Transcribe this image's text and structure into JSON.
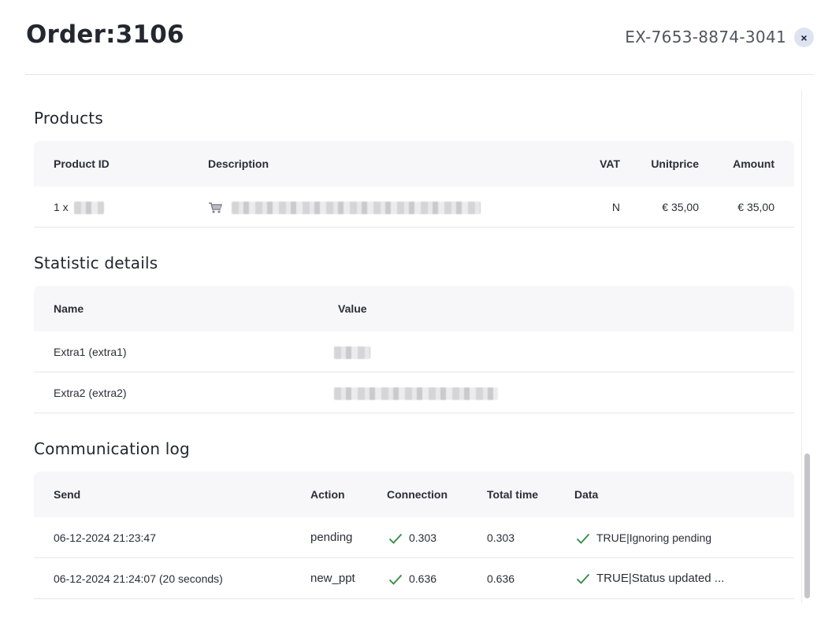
{
  "header": {
    "title": "Order:3106",
    "reference": "EX-7653-8874-3041",
    "close_label": "×"
  },
  "products": {
    "title": "Products",
    "columns": [
      "Product ID",
      "Description",
      "VAT",
      "Unitprice",
      "Amount"
    ],
    "rows": [
      {
        "qty": "1 x",
        "vat": "N",
        "unitprice": "€ 35,00",
        "amount": "€ 35,00"
      }
    ]
  },
  "statistics": {
    "title": "Statistic details",
    "columns": [
      "Name",
      "Value"
    ],
    "rows": [
      {
        "name": "Extra1 (extra1)"
      },
      {
        "name": "Extra2 (extra2)"
      }
    ]
  },
  "communication": {
    "title": "Communication log",
    "columns": [
      "Send",
      "Action",
      "Connection",
      "Total time",
      "Data"
    ],
    "rows": [
      {
        "send": "06-12-2024 21:23:47",
        "action": "pending",
        "connection": "0.303",
        "total_time": "0.303",
        "data": "TRUE|Ignoring pending"
      },
      {
        "send": "06-12-2024 21:24:07 (20 seconds)",
        "action": "new_ppt",
        "connection": "0.636",
        "total_time": "0.636",
        "data": "TRUE|Status updated ..."
      }
    ]
  },
  "colors": {
    "check": "#2e8b3e",
    "header_bg": "#f7f7f9",
    "close_bg": "#dde3f1"
  },
  "icons": {
    "close": "close-icon",
    "cart": "cart-icon",
    "check": "check-icon"
  }
}
